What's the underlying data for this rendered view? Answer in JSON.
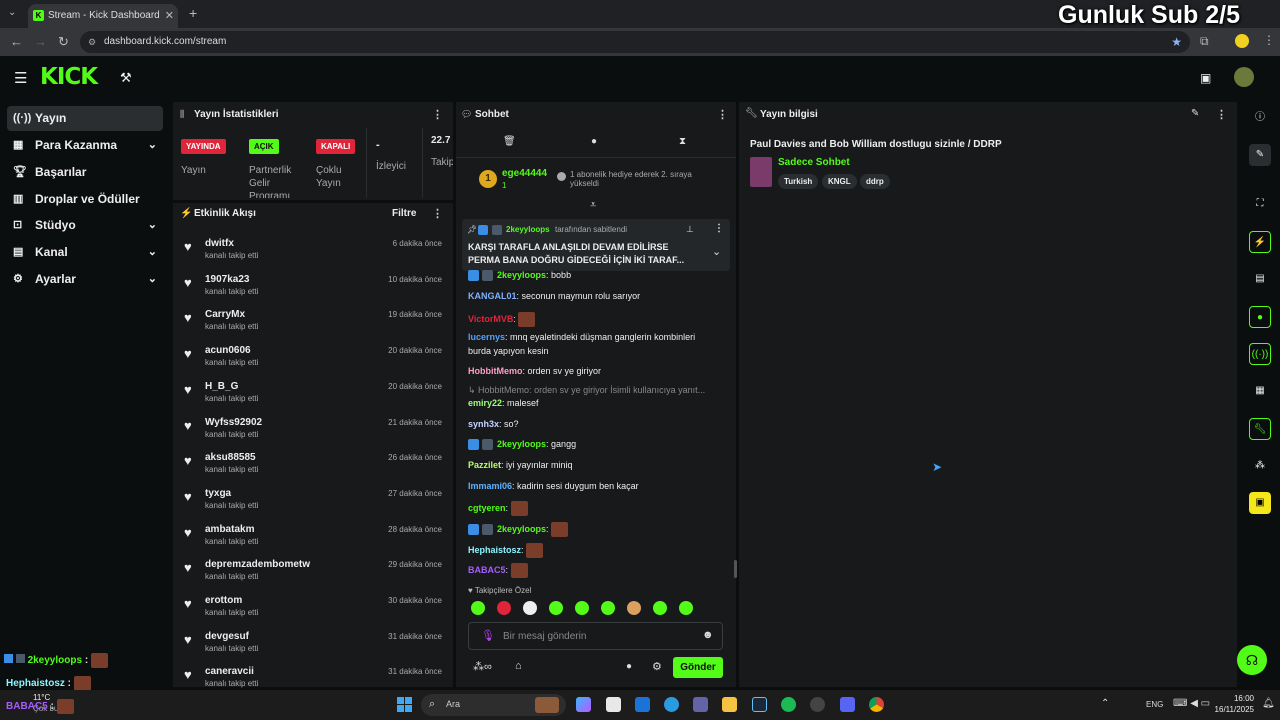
{
  "browser": {
    "tab_title": "Stream - Kick Dashboard",
    "url": "dashboard.kick.com/stream",
    "overlay_text": "Gunluk Sub 2/5"
  },
  "sidebar": {
    "items": [
      {
        "label": "Yayın",
        "icon": "broadcast-icon"
      },
      {
        "label": "Para Kazanma",
        "icon": "money-icon"
      },
      {
        "label": "Başarılar",
        "icon": "trophy-icon"
      },
      {
        "label": "Droplar ve Ödüller",
        "icon": "gift-icon"
      },
      {
        "label": "Stüdyo",
        "icon": "studio-icon"
      },
      {
        "label": "Kanal",
        "icon": "channel-icon"
      },
      {
        "label": "Ayarlar",
        "icon": "gear-icon"
      }
    ]
  },
  "stats": {
    "title": "Yayın İstatistikleri",
    "live_badge": "YAYINDA",
    "live_label": "Yayın",
    "partner_badge": "AÇIK",
    "partner_label": "Partnerlik Gelir Programı",
    "multi_badge": "KAPALI",
    "multi_label": "Çoklu Yayın",
    "viewers_value": "-",
    "viewers_label": "İzleyici",
    "followers_value": "22.7",
    "followers_label": "Takip"
  },
  "events": {
    "title": "Etkinlik Akışı",
    "filter_label": "Filtre",
    "action_text": "kanalı takip etti",
    "items": [
      {
        "name": "dwitfx",
        "time": "6 dakika önce"
      },
      {
        "name": "1907ka23",
        "time": "10 dakika önce"
      },
      {
        "name": "CarryMx",
        "time": "19 dakika önce"
      },
      {
        "name": "acun0606",
        "time": "20 dakika önce"
      },
      {
        "name": "H_B_G",
        "time": "20 dakika önce"
      },
      {
        "name": "Wyfss92902",
        "time": "21 dakika önce"
      },
      {
        "name": "aksu88585",
        "time": "26 dakika önce"
      },
      {
        "name": "tyxga",
        "time": "27 dakika önce"
      },
      {
        "name": "ambatakm",
        "time": "28 dakika önce"
      },
      {
        "name": "depremzadembometw",
        "time": "29 dakika önce"
      },
      {
        "name": "erottom",
        "time": "30 dakika önce"
      },
      {
        "name": "devgesuf",
        "time": "31 dakika önce"
      },
      {
        "name": "caneravcii",
        "time": "31 dakika önce"
      }
    ]
  },
  "chat": {
    "title": "Sohbet",
    "top_gifter": "ege44444",
    "top_gifter_count": "1",
    "top_rank": "1",
    "gift_note": "1 abonelik hediye ederek 2. sıraya yükseldi",
    "pinned_by": "2keyyloops",
    "pinned_suffix": "tarafından sabitlendi",
    "pinned_text": "KARŞI TARAFLA ANLAŞILDI DEVAM EDİLİRSE PERMA BANA DOĞRU GİDECEĞİ İÇİN İKİ TARAF...",
    "messages": [
      {
        "user": "2keyyloops",
        "text": "bobb",
        "color": "#53fc18"
      },
      {
        "user": "KANGAL01",
        "text": "seconun maymun rolu sarıyor",
        "color": "#7fb0ff"
      },
      {
        "user": "VictorMVB",
        "text": "",
        "color": "#e0243a"
      },
      {
        "user": "lucernys",
        "text": "mnq eyaletindeki düşman ganglerin kombinleri",
        "color": "#4da3ff"
      },
      {
        "user": "",
        "text": "burda yapıyon kesin",
        "color": "#eee"
      },
      {
        "user": "HobbitMemo",
        "text": "orden sv ye giriyor",
        "color": "#ff9ec7"
      },
      {
        "user": "",
        "text": "↳ HobbitMemo: orden sv ye giriyor  İsimli kullanıcıya yanıt...",
        "color": "#888"
      },
      {
        "user": "emiry22",
        "text": "malesef",
        "color": "#9dff7a"
      },
      {
        "user": "synh3x",
        "text": "so?",
        "color": "#c5d4ff"
      },
      {
        "user": "2keyyloops",
        "text": "gangg",
        "color": "#53fc18"
      },
      {
        "user": "Pazzilet",
        "text": "iyi yayınlar miniq",
        "color": "#b7ff6b"
      },
      {
        "user": "Immami06",
        "text": "kadirin sesi duygum ben kaçar",
        "color": "#5fb2ff"
      },
      {
        "user": "cgtyeren",
        "text": "",
        "color": "#53fc18"
      },
      {
        "user": "2keyyloops",
        "text": "",
        "color": "#53fc18"
      },
      {
        "user": "Hephaistosz",
        "text": "",
        "color": "#8df5ff"
      },
      {
        "user": "BABAC5",
        "text": "",
        "color": "#a65cff"
      }
    ],
    "followers_only_label": "Takipçilere Özel",
    "input_placeholder": "Bir mesaj gönderin",
    "send_label": "Gönder"
  },
  "stream_info": {
    "title": "Yayın bilgisi",
    "stream_title": "Paul Davies and Bob William dostlugu sizinle / DDRP",
    "category": "Sadece Sohbet",
    "tags": [
      "Turkish",
      "KNGL",
      "ddrp"
    ]
  },
  "overlay_chat": [
    {
      "user": "2keyyloops",
      "color": "#53fc18"
    },
    {
      "user": "Hephaistosz",
      "color": "#8df5ff"
    },
    {
      "user": "BABAC5",
      "color": "#a65cff"
    }
  ],
  "taskbar": {
    "search_label": "Ara",
    "weather": "11°C",
    "weather_desc": "Çok bul...",
    "language": "ENG",
    "time": "16:00",
    "date": "16/11/2025"
  }
}
